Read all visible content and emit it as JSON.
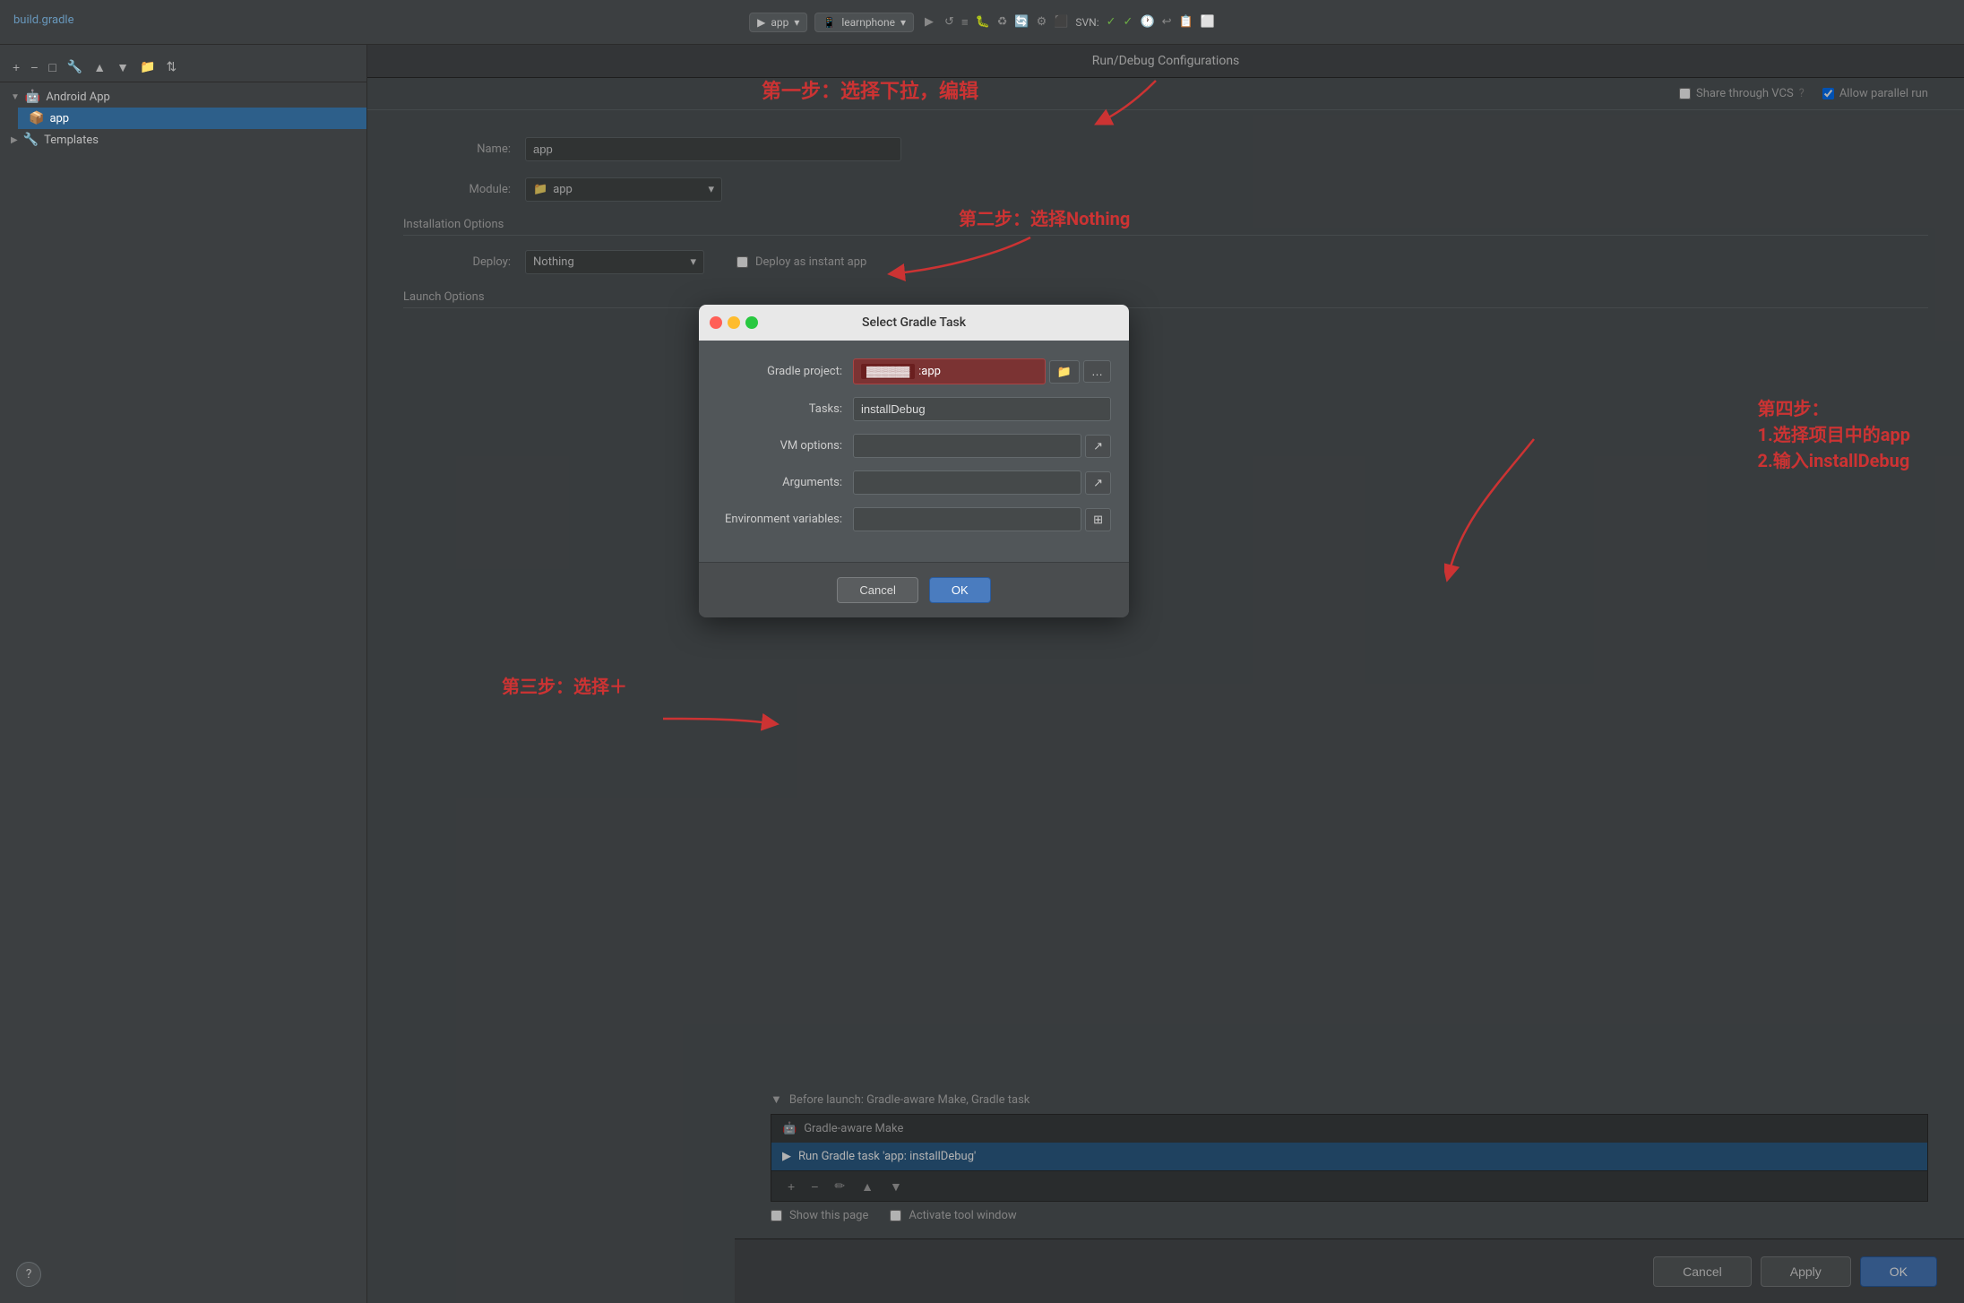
{
  "topbar": {
    "file_label": "build.gradle",
    "run_config_label": "app",
    "device_label": "learnphone",
    "svn_label": "SVN:",
    "toolbar_icons": [
      "▶",
      "↺",
      "≡",
      "🐛",
      "♻",
      "🔄",
      "⚙",
      "⬛",
      "📋"
    ]
  },
  "dialog_title": "Run/Debug Configurations",
  "sidebar": {
    "add_btn": "+",
    "remove_btn": "−",
    "copy_btn": "□",
    "wrench_btn": "🔧",
    "up_btn": "▲",
    "down_btn": "▼",
    "folder_btn": "📁",
    "sort_btn": "⇅",
    "tree_items": [
      {
        "label": "Android App",
        "type": "android",
        "expanded": true
      },
      {
        "label": "app",
        "type": "app",
        "indent": true,
        "selected": false
      },
      {
        "label": "Templates",
        "type": "wrench",
        "expanded": false
      }
    ]
  },
  "top_options": {
    "share_vcs_label": "Share through VCS",
    "vcs_help": "?",
    "allow_parallel_label": "Allow parallel run",
    "allow_parallel_checked": true
  },
  "config_form": {
    "name_label": "Name:",
    "name_value": "app",
    "module_label": "Module:",
    "module_value": "app",
    "installation_header": "Installation Options",
    "deploy_label": "Deploy:",
    "deploy_value": "Nothing",
    "deploy_instant_label": "Deploy as instant app",
    "launch_header": "Launch Options"
  },
  "annotations": {
    "step1": "第一步：选择下拉，编辑",
    "step2": "第二步：选择Nothing",
    "step3": "第三步：选择＋",
    "step4_line1": "第四步：",
    "step4_line2": "1.选择项目中的app",
    "step4_line3": "2.输入installDebug"
  },
  "gradle_dialog": {
    "title": "Select Gradle Task",
    "project_label": "Gradle project:",
    "project_value": ":app",
    "tasks_label": "Tasks:",
    "tasks_value": "installDebug",
    "vm_label": "VM options:",
    "vm_value": "",
    "arguments_label": "Arguments:",
    "arguments_value": "",
    "env_label": "Environment variables:",
    "env_value": "",
    "cancel_btn": "Cancel",
    "ok_btn": "OK"
  },
  "before_launch": {
    "header": "Before launch: Gradle-aware Make, Gradle task",
    "items": [
      {
        "label": "Gradle-aware Make",
        "selected": false
      },
      {
        "label": "Run Gradle task 'app: installDebug'",
        "selected": true
      }
    ],
    "add_btn": "+",
    "remove_btn": "−",
    "edit_btn": "✏",
    "up_btn": "▲",
    "down_btn": "▼",
    "show_page_label": "Show this page",
    "activate_label": "Activate tool window"
  },
  "bottom_buttons": {
    "cancel_label": "Cancel",
    "apply_label": "Apply",
    "ok_label": "OK"
  },
  "help_btn": "?"
}
